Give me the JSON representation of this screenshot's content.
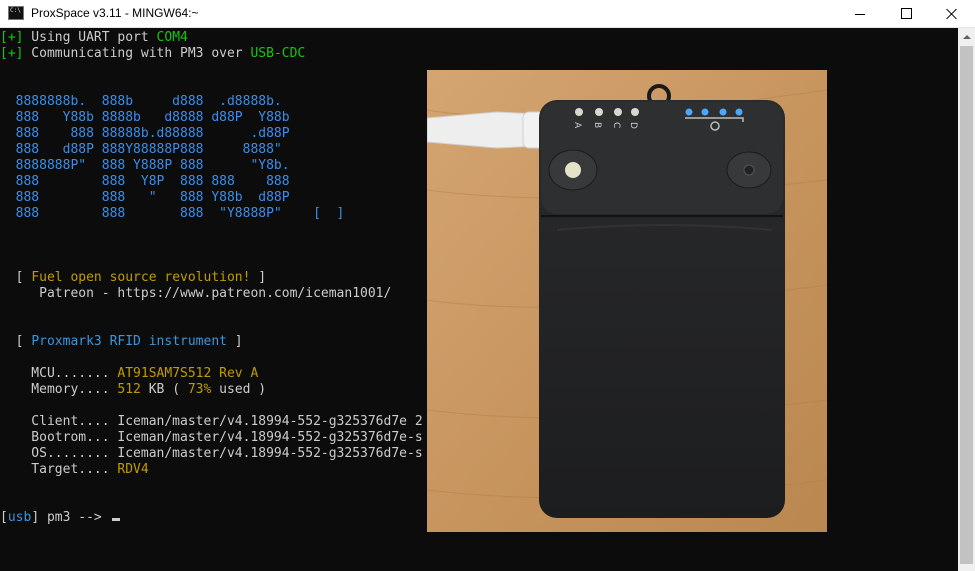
{
  "window": {
    "title": "ProxSpace v3.11 - MINGW64:~"
  },
  "terminal": {
    "uart_prefix": "[+]",
    "uart_text": " Using UART port ",
    "uart_port": "COM4",
    "comm_prefix": "[+]",
    "comm_text": " Communicating with PM3 over ",
    "comm_value": "USB-CDC",
    "ascii_art": [
      "  8888888b.  888b     d888  .d8888b.",
      "  888   Y88b 8888b   d8888 d88P  Y88b",
      "  888    888 88888b.d88888      .d88P",
      "  888   d88P 888Y88888P888     8888\"",
      "  8888888P\"  888 Y888P 888      \"Y8b.",
      "  888        888  Y8P  888 888    888",
      "  888        888   \"   888 Y88b  d88P",
      "  888        888       888  \"Y8888P\"    [  ]"
    ],
    "fuel_open": "  [ ",
    "fuel_text": "Fuel open source revolution!",
    "fuel_close": " ]",
    "patreon": "     Patreon - https://www.patreon.com/iceman1001/",
    "instrument_open": "  [ ",
    "instrument_text": "Proxmark3 RFID instrument",
    "instrument_close": " ]",
    "mcu_label": "    MCU....... ",
    "mcu_value": "AT91SAM7S512 Rev A",
    "memory_label": "    Memory.... ",
    "memory_size": "512",
    "memory_unit": " KB ( ",
    "memory_pct": "73%",
    "memory_tail": " used )",
    "client_line": "    Client.... Iceman/master/v4.18994-552-g325376d7e 2",
    "bootrom_line": "    Bootrom... Iceman/master/v4.18994-552-g325376d7e-s",
    "os_line": "    OS........ Iceman/master/v4.18994-552-g325376d7e-s",
    "target_label": "    Target.... ",
    "target_value": "RDV4",
    "prompt_open": "[",
    "prompt_usb": "usb",
    "prompt_close": "] pm3 --> "
  },
  "colors": {
    "background": "#0c0c0c",
    "text": "#cccccc",
    "green": "#16c60c",
    "blue": "#3b8eea",
    "yellow": "#c19c00"
  },
  "photo": {
    "port_labels": [
      "A",
      "B",
      "C",
      "D"
    ]
  }
}
